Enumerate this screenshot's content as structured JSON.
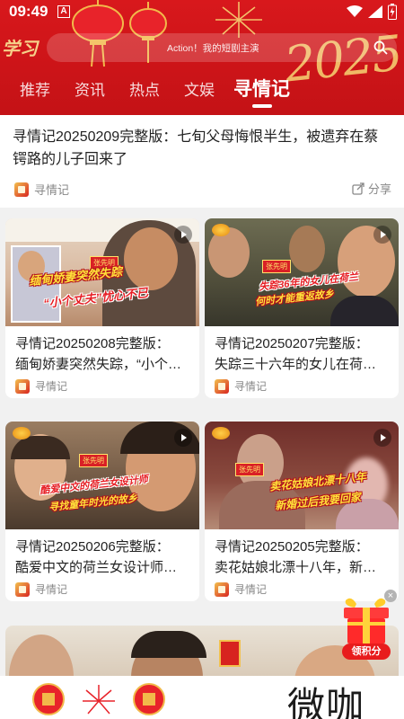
{
  "status_bar": {
    "time": "09:49",
    "a_icon": "A"
  },
  "header": {
    "logo_text": "学习",
    "search_placeholder": "Action！我的短剧主演",
    "year_art": "2025",
    "tabs": [
      {
        "label": "推荐",
        "active": false
      },
      {
        "label": "资讯",
        "active": false
      },
      {
        "label": "热点",
        "active": false
      },
      {
        "label": "文娱",
        "active": false
      },
      {
        "label": "寻情记",
        "active": true
      }
    ]
  },
  "feed": {
    "top_article": {
      "title": "寻情记20250209完整版：七旬父母悔恨半生，被遗弃在蔡锷路的儿子回来了",
      "source": "寻情记",
      "share_label": "分享"
    },
    "cards": [
      {
        "title_line1": "寻情记20250208完整版：",
        "title_line2": "缅甸娇妻突然失踪，“小个…",
        "source": "寻情记",
        "caption_line1": "缅甸娇妻突然失踪",
        "caption_line2": "“小个丈夫”忧心不已",
        "photo_label": "张先明"
      },
      {
        "title_line1": "寻情记20250207完整版：",
        "title_line2": "失踪三十六年的女儿在荷…",
        "source": "寻情记",
        "caption_line1": "失踪36年的女儿在荷兰",
        "caption_line2": "何时才能重返故乡",
        "photo_label": "张先明"
      },
      {
        "title_line1": "寻情记20250206完整版：",
        "title_line2": "酷爱中文的荷兰女设计师…",
        "source": "寻情记",
        "caption_line1": "酷爱中文的荷兰女设计师",
        "caption_line2": "寻找童年时光的故乡",
        "photo_label": "张先明"
      },
      {
        "title_line1": "寻情记20250205完整版：",
        "title_line2": "卖花姑娘北漂十八年，新…",
        "source": "寻情记",
        "caption_line1": "卖花姑娘北漂十八年",
        "caption_line2": "新婚过后我要回家",
        "photo_label": "张先明"
      }
    ],
    "gift_label": "领积分",
    "close_label": "×"
  },
  "bottom": {
    "watermark": "微咖"
  }
}
